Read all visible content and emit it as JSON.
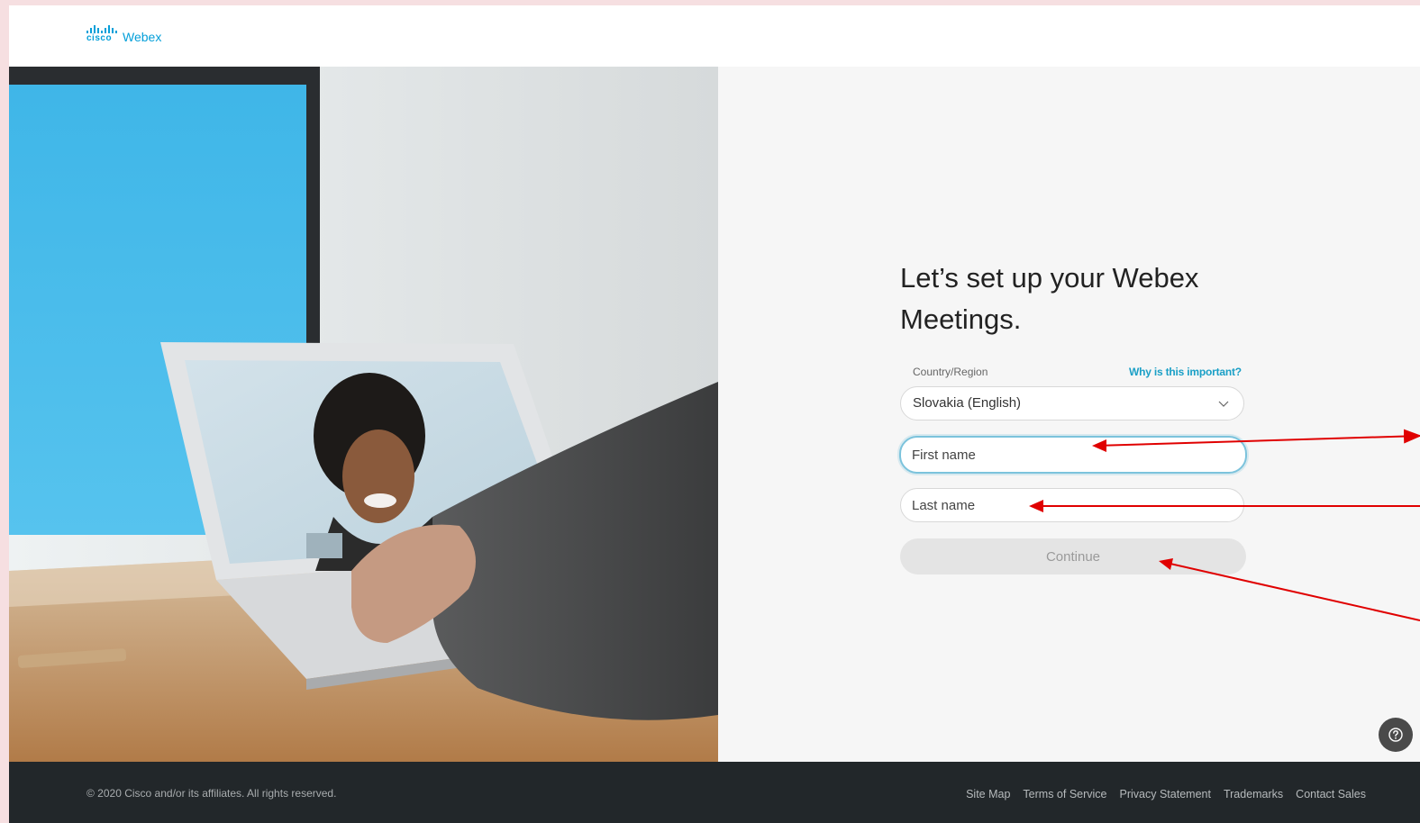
{
  "brand": {
    "cisco": "cisco",
    "product": "Webex",
    "color": "#049fd9"
  },
  "form": {
    "title": "Let’s set up your Webex Meetings.",
    "country_label": "Country/Region",
    "why_link": "Why is this important?",
    "country_value": "Slovakia (English)",
    "first_name_placeholder": "First name",
    "last_name_placeholder": "Last name",
    "continue_label": "Continue"
  },
  "footer": {
    "copyright": "© 2020 Cisco and/or its affiliates. All rights reserved.",
    "links": [
      "Site Map",
      "Terms of Service",
      "Privacy Statement",
      "Trademarks",
      "Contact Sales"
    ]
  },
  "icons": {
    "help": "help-icon",
    "chevron": "chevron-down-icon"
  },
  "colors": {
    "accent": "#1a9fc6",
    "annotation_arrow": "#e00000",
    "footer_bg": "#22272a"
  }
}
